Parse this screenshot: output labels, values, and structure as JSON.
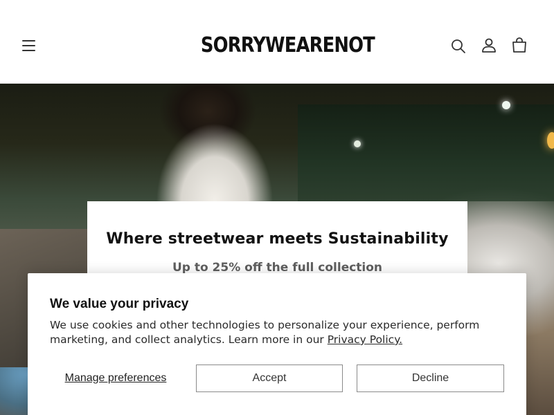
{
  "header": {
    "logo_text": "SORRYWEARENOT",
    "icons": [
      "menu-icon",
      "search-icon",
      "account-icon",
      "cart-icon"
    ]
  },
  "hero": {
    "promo_title": "Where streetwear meets Sustainability",
    "promo_subtitle": "Up to 25% off the full collection"
  },
  "cookie": {
    "title": "We value your privacy",
    "text_prefix": "We use cookies and other technologies to personalize your experience, perform marketing, and collect analytics. Learn more in our ",
    "policy_link": "Privacy Policy.",
    "manage_label": "Manage preferences",
    "accept_label": "Accept",
    "decline_label": "Decline"
  },
  "colors": {
    "text": "#121212",
    "subtitle": "#5f5f5f",
    "button_border": "#8a8a8a"
  }
}
